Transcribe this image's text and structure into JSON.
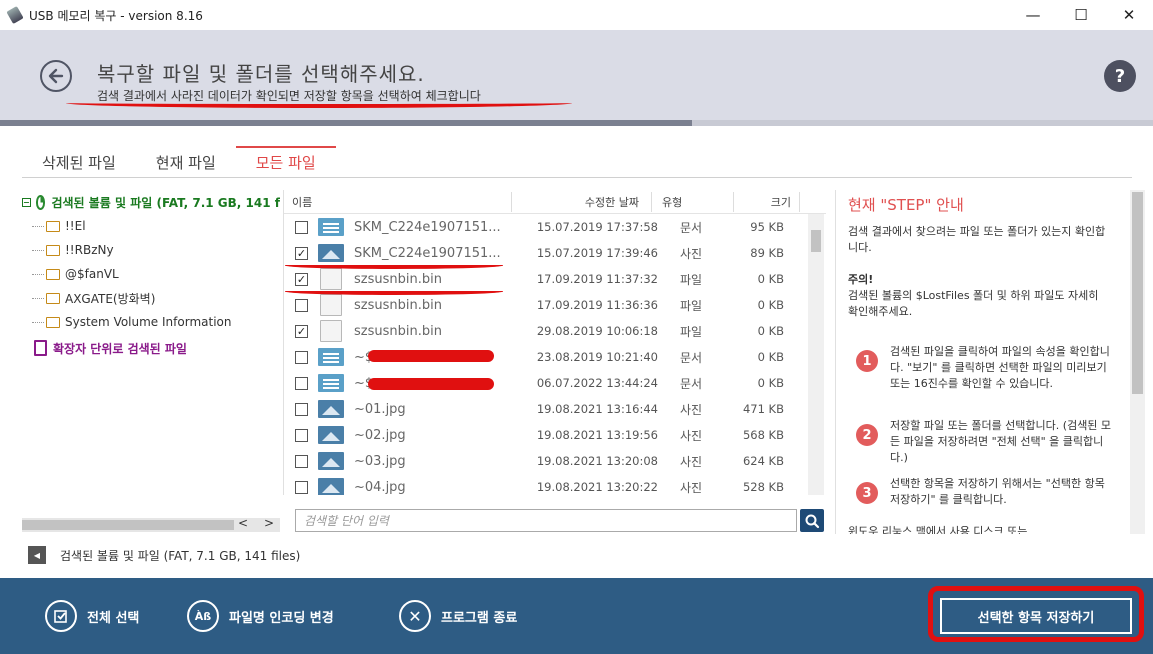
{
  "window": {
    "title": "USB 메모리 복구 - version 8.16",
    "minimize": "—",
    "maximize": "☐",
    "close": "✕"
  },
  "header": {
    "title": "복구할 파일 및 폴더를 선택해주세요.",
    "subtitle": "검색 결과에서 사라진 데이터가 확인되면 저장할 항목을 선택하여 체크합니다",
    "help": "?",
    "progress_fraction": 0.6
  },
  "tabs": [
    "삭제된 파일",
    "현재 파일",
    "모든 파일"
  ],
  "active_tab": 2,
  "tree": {
    "root": "검색된 볼륨 및 파일 (FAT, 7.1 GB, 141 f",
    "root_toggle": "−",
    "children": [
      "!!El",
      "!!RBzNy",
      "@$fanVL",
      "AXGATE(방화벽)",
      "System Volume Information"
    ],
    "ext_item": "확장자 단위로 검색된 파일",
    "scroll_left": "<",
    "scroll_right": ">"
  },
  "columns": {
    "name": "이름",
    "date": "수정한 날짜",
    "type": "유형",
    "size": "크기"
  },
  "rows": [
    {
      "checked": false,
      "icon": "doc",
      "name": "SKM_C224e1907151...",
      "date": "15.07.2019 17:37:58",
      "type": "문서",
      "size": "95 KB"
    },
    {
      "checked": true,
      "icon": "img",
      "name": "SKM_C224e1907151...",
      "date": "15.07.2019 17:39:46",
      "type": "사진",
      "size": "89 KB"
    },
    {
      "checked": true,
      "icon": "file",
      "name": "szsusnbin.bin",
      "date": "17.09.2019 11:37:32",
      "type": "파일",
      "size": "0 KB"
    },
    {
      "checked": false,
      "icon": "file",
      "name": "szsusnbin.bin",
      "date": "17.09.2019 11:36:36",
      "type": "파일",
      "size": "0 KB"
    },
    {
      "checked": true,
      "icon": "file",
      "name": "szsusnbin.bin",
      "date": "29.08.2019 10:06:18",
      "type": "파일",
      "size": "0 KB"
    },
    {
      "checked": false,
      "icon": "doc",
      "name": "~$",
      "date": "23.08.2019 10:21:40",
      "type": "문서",
      "size": "0 KB"
    },
    {
      "checked": false,
      "icon": "doc",
      "name": "~$",
      "date": "06.07.2022 13:44:24",
      "type": "문서",
      "size": "0 KB"
    },
    {
      "checked": false,
      "icon": "img",
      "name": "~01.jpg",
      "date": "19.08.2021 13:16:44",
      "type": "사진",
      "size": "471 KB"
    },
    {
      "checked": false,
      "icon": "img",
      "name": "~02.jpg",
      "date": "19.08.2021 13:19:56",
      "type": "사진",
      "size": "568 KB"
    },
    {
      "checked": false,
      "icon": "img",
      "name": "~03.jpg",
      "date": "19.08.2021 13:20:08",
      "type": "사진",
      "size": "624 KB"
    },
    {
      "checked": false,
      "icon": "img",
      "name": "~04.jpg",
      "date": "19.08.2021 13:20:22",
      "type": "사진",
      "size": "528 KB"
    }
  ],
  "search": {
    "placeholder": "검색할 단어 입력"
  },
  "guide": {
    "title": "현재 \"STEP\" 안내",
    "intro": "검색 결과에서 찾으려는 파일 또는 폴더가 있는지 확인합니다.",
    "caution_title": "주의!",
    "caution": "검색된 볼륨의 $LostFiles 폴더 및 하위 파일도 자세히 확인해주세요.",
    "steps": [
      {
        "num": "1",
        "text": "검색된 파일을 클릭하여 파일의 속성을 확인합니다. \"보기\" 를 클릭하면 선택한 파일의 미리보기 또는 16진수를 확인할 수 있습니다."
      },
      {
        "num": "2",
        "text": "저장할 파일 또는 폴더를 선택합니다. (검색된 모든 파일을 저장하려면 \"전체 선택\" 을 클릭합니다.)"
      },
      {
        "num": "3",
        "text": "선택한 항목을 저장하기 위해서는 \"선택한 항목 저장하기\" 를 클릭합니다."
      }
    ],
    "cut_line": "윈도우 리눅스 맥에서 사용 디스크 또는"
  },
  "status": {
    "text": "검색된 볼륨 및 파일 (FAT, 7.1 GB, 141 files)",
    "button": "◀"
  },
  "footer": {
    "select_all": "전체 선택",
    "encoding": "파일명 인코딩 변경",
    "encoding_icon": "Àß",
    "exit": "프로그램 종료",
    "exit_icon": "✕",
    "save_selected": "선택한 항목 저장하기"
  },
  "colors": {
    "header_bg": "#dadce6",
    "footer_bg": "#2e5c84",
    "accent_red": "#e04848",
    "tree_green": "#1a7a20",
    "ext_purple": "#8a1a8a",
    "annotation_red": "#e01010"
  }
}
